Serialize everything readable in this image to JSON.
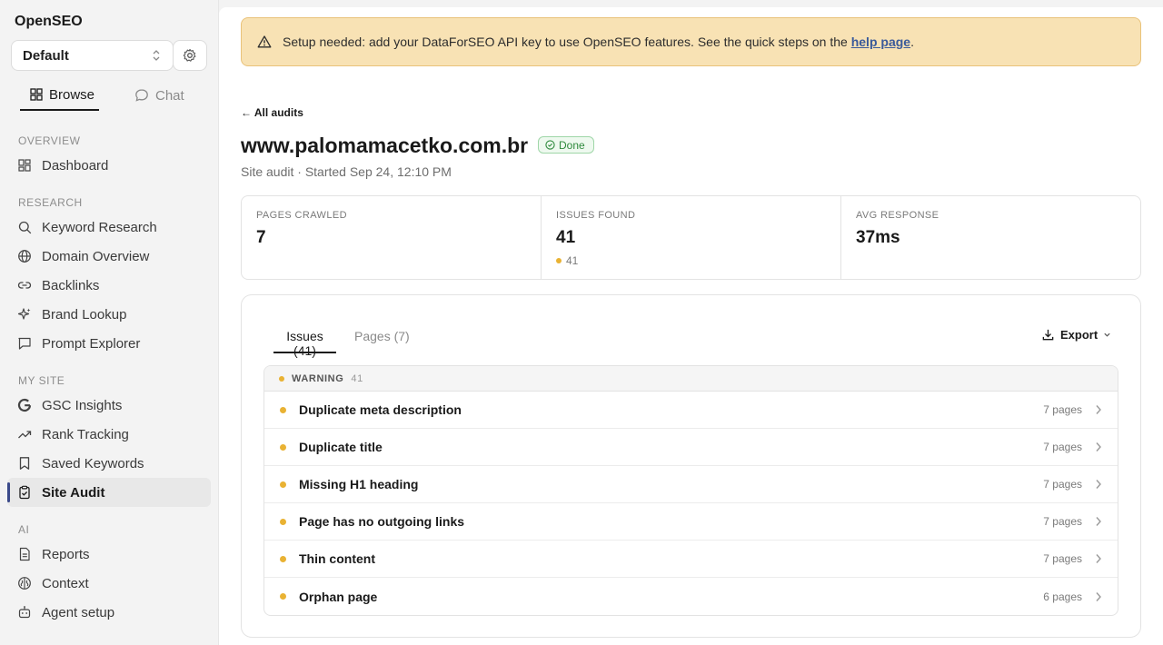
{
  "sidebar": {
    "app_title": "OpenSEO",
    "project": "Default",
    "tabs": {
      "browse": "Browse",
      "chat": "Chat"
    },
    "sections": {
      "overview": "OVERVIEW",
      "research": "RESEARCH",
      "my_site": "MY SITE",
      "ai": "AI"
    },
    "items": {
      "dashboard": "Dashboard",
      "keyword_research": "Keyword Research",
      "domain_overview": "Domain Overview",
      "backlinks": "Backlinks",
      "brand_lookup": "Brand Lookup",
      "prompt_explorer": "Prompt Explorer",
      "gsc_insights": "GSC Insights",
      "rank_tracking": "Rank Tracking",
      "saved_keywords": "Saved Keywords",
      "site_audit": "Site Audit",
      "reports": "Reports",
      "context": "Context",
      "agent_setup": "Agent setup"
    }
  },
  "banner": {
    "text": "Setup needed: add your DataForSEO API key to use OpenSEO features. See the quick steps on the ",
    "link": "help page",
    "suffix": "."
  },
  "audit": {
    "back_link": "← All audits",
    "domain": "www.palomamacetko.com.br",
    "status": "Done",
    "subtitle": "Site audit · Started Sep 24, 12:10 PM"
  },
  "stats": [
    {
      "label": "PAGES CRAWLED",
      "value": "7"
    },
    {
      "label": "ISSUES FOUND",
      "value": "41",
      "sub": "41"
    },
    {
      "label": "AVG RESPONSE",
      "value": "37ms"
    }
  ],
  "panel": {
    "tab_issues": "Issues (41)",
    "tab_pages": "Pages (7)",
    "export": "Export",
    "group_label": "WARNING",
    "group_count": "41",
    "issues": [
      {
        "title": "Duplicate meta description",
        "pages": "7 pages"
      },
      {
        "title": "Duplicate title",
        "pages": "7 pages"
      },
      {
        "title": "Missing H1 heading",
        "pages": "7 pages"
      },
      {
        "title": "Page has no outgoing links",
        "pages": "7 pages"
      },
      {
        "title": "Thin content",
        "pages": "7 pages"
      },
      {
        "title": "Orphan page",
        "pages": "6 pages"
      }
    ]
  },
  "colors": {
    "warning_dot": "#e9b233",
    "banner_bg": "#f8e2b4",
    "active_accent": "#3b4a8a",
    "status_done": "#2f8a3d"
  }
}
